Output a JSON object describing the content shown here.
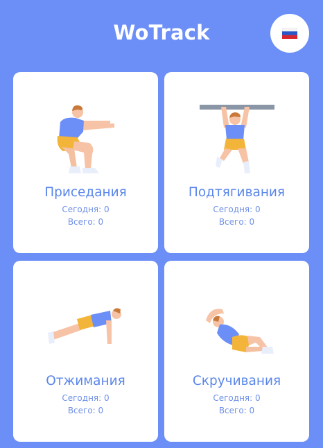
{
  "app": {
    "title": "WoTrack",
    "language_flag": "russian-flag-icon"
  },
  "colors": {
    "background": "#6b8ef7",
    "card": "#ffffff",
    "accent_text": "#5a86ea",
    "shirt": "#6b8ef7",
    "shorts": "#f3b43a",
    "skin": "#f7c3a6",
    "hair": "#c97a3a",
    "bar": "#8a96a5"
  },
  "exercises": [
    {
      "name": "Приседания",
      "icon": "squat-icon",
      "today_label": "Сегодня: 0",
      "total_label": "Всего: 0"
    },
    {
      "name": "Подтягивания",
      "icon": "pullup-icon",
      "today_label": "Сегодня: 0",
      "total_label": "Всего: 0"
    },
    {
      "name": "Отжимания",
      "icon": "pushup-icon",
      "today_label": "Сегодня: 0",
      "total_label": "Всего: 0"
    },
    {
      "name": "Скручивания",
      "icon": "crunch-icon",
      "today_label": "Сегодня: 0",
      "total_label": "Всего: 0"
    }
  ]
}
